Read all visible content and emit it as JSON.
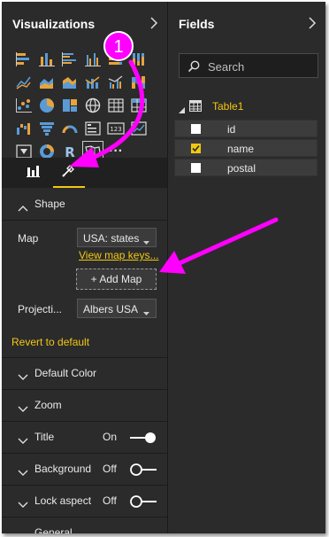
{
  "visualizations": {
    "title": "Visualizations",
    "icons": [
      "stacked-bar-chart-icon",
      "stacked-column-chart-icon",
      "clustered-bar-chart-icon",
      "clustered-column-chart-icon",
      "100-percent-bar-chart-icon",
      "100-percent-column-chart-icon",
      "line-chart-icon",
      "area-chart-icon",
      "stacked-area-chart-icon",
      "line-column-chart-icon",
      "line-clustered-column-chart-icon",
      "ribbon-chart-icon",
      "scatter-chart-icon",
      "pie-chart-icon",
      "treemap-icon",
      "globe-map-icon",
      "table-icon",
      "matrix-icon",
      "waterfall-chart-icon",
      "funnel-chart-icon",
      "gauge-icon",
      "multi-row-card-icon",
      "card-icon",
      "kpi-icon",
      "slicer-icon",
      "donut-chart-icon",
      "r-script-icon",
      "shape-map-icon",
      "more-visuals-icon"
    ],
    "more_label": "···",
    "tabs": [
      "fields-tab",
      "format-tab"
    ]
  },
  "format": {
    "shape": {
      "header": "Shape",
      "map_label": "Map",
      "map_value": "USA: states",
      "view_keys_link": "View map keys...",
      "add_map_button": "+ Add Map",
      "projection_label": "Projecti...",
      "projection_value": "Albers USA"
    },
    "revert": "Revert to default",
    "sections": {
      "default_color": "Default Color",
      "zoom": "Zoom",
      "title": "Title",
      "title_state": "On",
      "background": "Background",
      "background_state": "Off",
      "lock_aspect": "Lock aspect",
      "lock_aspect_state": "Off",
      "general": "General"
    }
  },
  "fields": {
    "title": "Fields",
    "search_placeholder": "Search",
    "table_name": "Table1",
    "items": [
      {
        "name": "id",
        "checked": false
      },
      {
        "name": "name",
        "checked": true
      },
      {
        "name": "postal",
        "checked": false
      }
    ]
  },
  "annotation": {
    "step_number": "1",
    "color": "#ff00ff"
  },
  "colors": {
    "accent": "#f2c811",
    "pane_bg": "#2b2b2b",
    "annotation": "#ff00ff"
  }
}
